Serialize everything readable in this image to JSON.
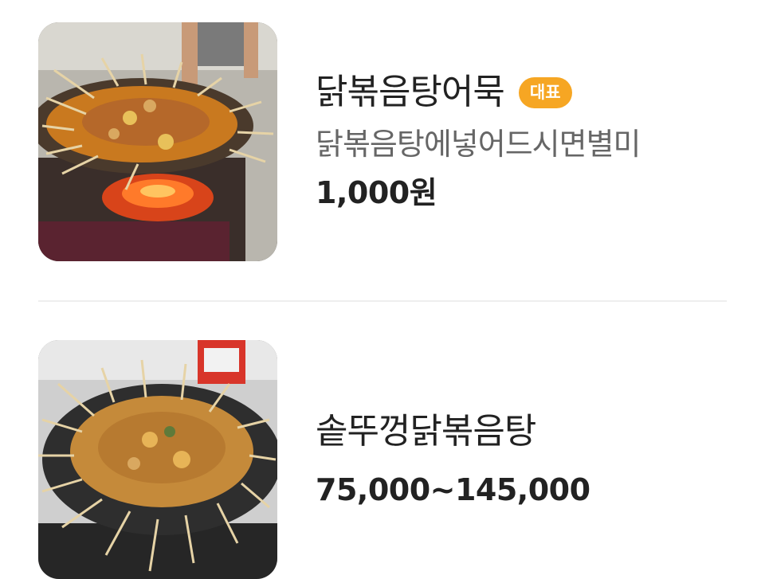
{
  "menu": {
    "items": [
      {
        "name": "닭볶음탕어묵",
        "badge": "대표",
        "description": "닭볶음탕에넣어드시면별미",
        "price": "1,000원",
        "image_icon": "food-photo-icon"
      },
      {
        "name": "솥뚜껑닭볶음탕",
        "price": "75,000~145,000",
        "image_icon": "food-photo-icon"
      }
    ]
  },
  "colors": {
    "badge_bg": "#f6a623",
    "text_primary": "#222222",
    "text_secondary": "#666666",
    "divider": "#eeeeee"
  }
}
